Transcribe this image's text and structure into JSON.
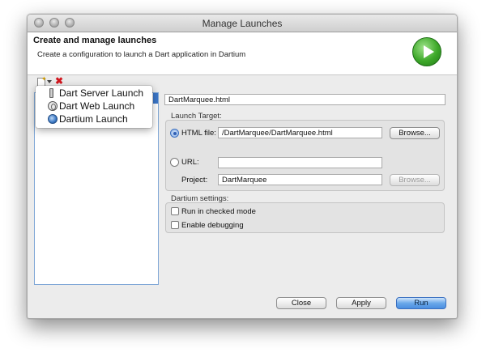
{
  "window": {
    "title": "Manage Launches"
  },
  "banner": {
    "title": "Create and manage launches",
    "description": "Create a configuration to launch a Dart application in Dartium"
  },
  "popup_menu": {
    "items": [
      {
        "label": "Dart Server Launch",
        "icon": "server-icon"
      },
      {
        "label": "Dart Web Launch",
        "icon": "web-globe-icon"
      },
      {
        "label": "Dartium Launch",
        "icon": "dartium-icon"
      }
    ]
  },
  "config": {
    "name_value": "DartMarquee.html",
    "launch_target_label": "Launch Target:",
    "html_file_label": "HTML file:",
    "html_file_value": "/DartMarquee/DartMarquee.html",
    "browse_label": "Browse...",
    "url_label": "URL:",
    "url_value": "",
    "project_label": "Project:",
    "project_value": "DartMarquee",
    "project_browse_label": "Browse...",
    "dartium_settings_label": "Dartium settings:",
    "checked_mode_label": "Run in checked mode",
    "debugging_label": "Enable debugging"
  },
  "footer": {
    "close_label": "Close",
    "apply_label": "Apply",
    "run_label": "Run"
  },
  "colors": {
    "accent_blue": "#3c77c9",
    "run_green": "#3da829",
    "delete_red": "#d2161e"
  }
}
